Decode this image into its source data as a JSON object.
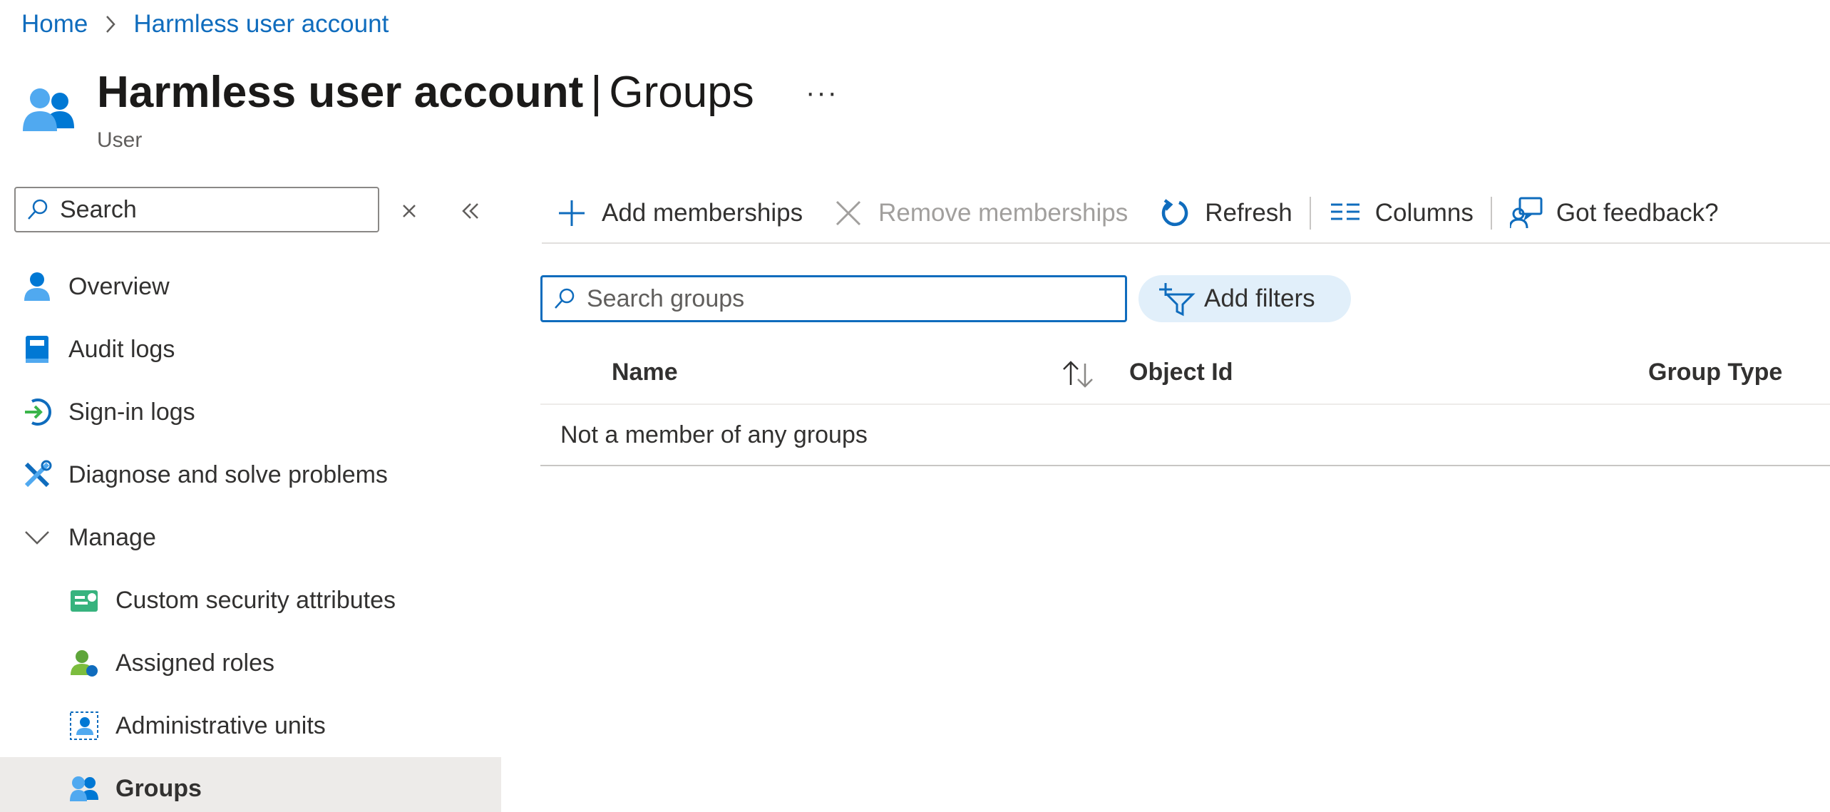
{
  "breadcrumb": {
    "home": "Home",
    "current": "Harmless user account"
  },
  "header": {
    "title_bold": "Harmless user account",
    "title_separator": "|",
    "title_section": "Groups",
    "subtitle": "User",
    "more": "···",
    "icon": "user-icon"
  },
  "sidebar": {
    "search_placeholder": "Search",
    "items": [
      {
        "label": "Overview",
        "icon": "user-icon"
      },
      {
        "label": "Audit logs",
        "icon": "book-icon"
      },
      {
        "label": "Sign-in logs",
        "icon": "sign-in-icon"
      },
      {
        "label": "Diagnose and solve problems",
        "icon": "wrench-icon"
      },
      {
        "label": "Manage",
        "icon": "chevron-down-icon"
      },
      {
        "label": "Custom security attributes",
        "icon": "security-attributes-icon"
      },
      {
        "label": "Assigned roles",
        "icon": "assigned-roles-icon"
      },
      {
        "label": "Administrative units",
        "icon": "admin-units-icon"
      },
      {
        "label": "Groups",
        "icon": "groups-icon"
      }
    ]
  },
  "toolbar": {
    "add": "Add memberships",
    "remove": "Remove memberships",
    "refresh": "Refresh",
    "columns": "Columns",
    "feedback": "Got feedback?"
  },
  "filters": {
    "search_placeholder": "Search groups",
    "add_filters": "Add filters"
  },
  "table": {
    "columns": [
      "Name",
      "Object Id",
      "Group Type"
    ],
    "empty_message": "Not a member of any groups"
  },
  "colors": {
    "link": "#0f6cbd",
    "accent": "#0078d4",
    "active_nav": "#edebe9",
    "filter_pill": "#e1effa"
  }
}
